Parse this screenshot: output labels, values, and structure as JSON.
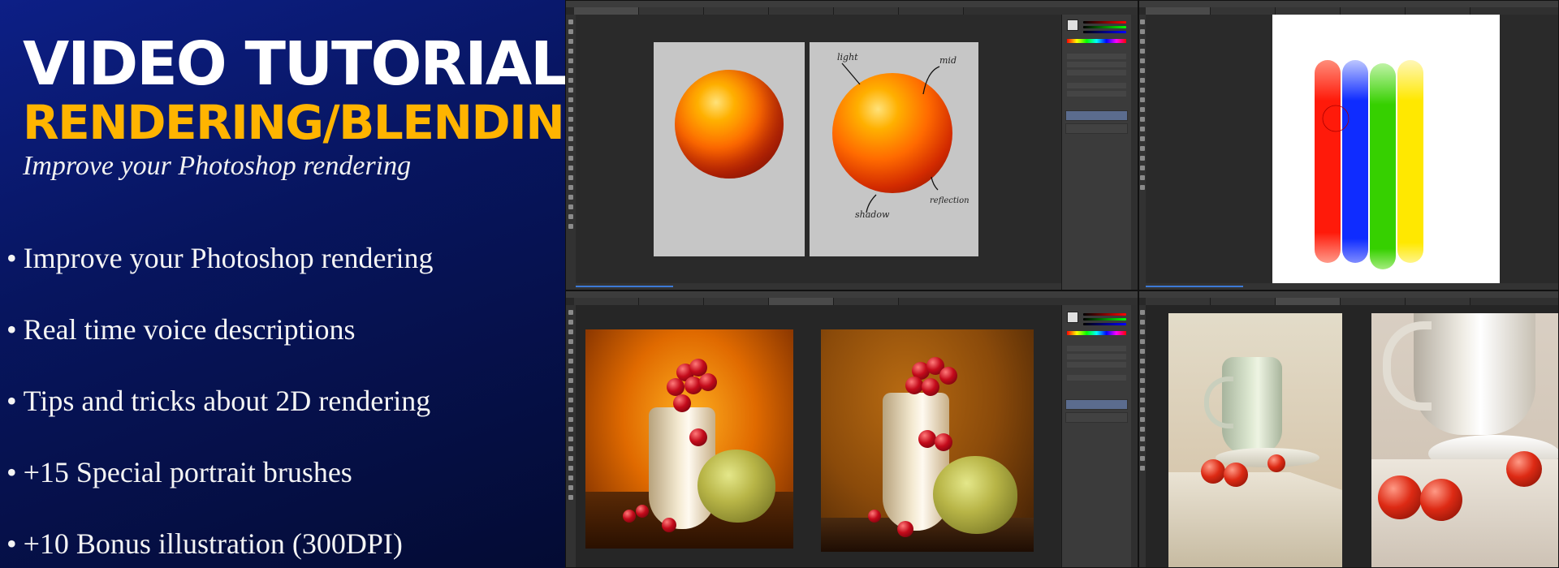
{
  "promo": {
    "title": "VIDEO TUTORIAL",
    "subtitle": "RENDERING/BLENDING",
    "tagline": "Improve your Photoshop rendering",
    "bullet_glyph": "•",
    "features": [
      "Improve your Photoshop rendering",
      "Real time voice descriptions",
      "Tips and tricks about 2D rendering",
      "+15 Special portrait brushes",
      "+10 Bonus illustration (300DPI)"
    ]
  },
  "colors": {
    "promo_bg": "#0d1f86",
    "subtitle": "#ffb400",
    "strokes": [
      "#ff1a0a",
      "#0f2cff",
      "#36d000",
      "#ffe800"
    ],
    "ps_bg": "#282828"
  },
  "annotations": {
    "light": "light",
    "mid": "mid",
    "shadow": "shadow",
    "reflection": "reflection"
  },
  "icons": [
    "tool-icon",
    "layer-thumb-icon",
    "color-swatch-icon"
  ]
}
